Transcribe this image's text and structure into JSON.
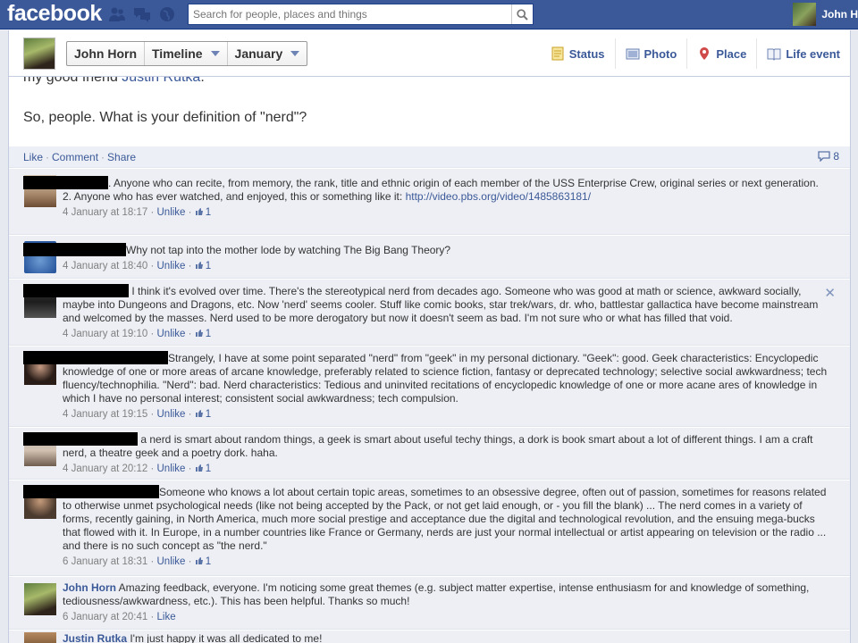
{
  "topbar": {
    "logo": "facebook",
    "search_placeholder": "Search for people, places and things",
    "user_name": "John H"
  },
  "timeline_header": {
    "crumbs": [
      {
        "label": "John Horn",
        "dropdown": false
      },
      {
        "label": "Timeline",
        "dropdown": true
      },
      {
        "label": "January",
        "dropdown": true
      }
    ],
    "composer": [
      {
        "label": "Status",
        "icon": "status-icon"
      },
      {
        "label": "Photo",
        "icon": "photo-icon"
      },
      {
        "label": "Place",
        "icon": "place-icon"
      },
      {
        "label": "Life event",
        "icon": "life-event-icon"
      }
    ]
  },
  "post": {
    "partial_line_prefix": "my good friend ",
    "partial_line_link": "Justin Rutka",
    "partial_line_suffix": ".",
    "question": "So, people. What is your definition of \"nerd\"?",
    "actions": {
      "like": "Like",
      "comment": "Comment",
      "share": "Share"
    },
    "comment_count": "8"
  },
  "comments": [
    {
      "text": ". Anyone who can recite, from memory, the rank, title and ethnic origin of each member of the USS Enterprise Crew, original series or next generation.",
      "text2_prefix": "2. Anyone who has ever watched, and enjoyed, this or something like it: ",
      "url": "http://video.pbs.org/video/1485863181/",
      "date": "4 January at 18:17",
      "action": "Unlike",
      "likes": "1"
    },
    {
      "text": "Why not tap into the mother lode by watching The Big Bang Theory?",
      "date": "4 January at 18:40",
      "action": "Unlike",
      "likes": "1"
    },
    {
      "text": " I think it's evolved over time. There's the stereotypical nerd from decades ago. Someone who was good at math or science, awkward socially, maybe into Dungeons and Dragons, etc. Now 'nerd' seems cooler. Stuff like comic books, star trek/wars, dr. who, battlestar gallactica have become mainstream and welcomed by the masses. Nerd used to be more derogatory but now it doesn't seem as bad. I'm not sure who or what has filled that void.",
      "date": "4 January at 19:10",
      "action": "Unlike",
      "likes": "1"
    },
    {
      "text": "Strangely, I have at some point separated \"nerd\" from \"geek\" in my personal dictionary. \"Geek\": good. Geek characteristics: Encyclopedic knowledge of one or more areas of arcane knowledge, preferably related to science fiction, fantasy or deprecated technology; selective social awkwardness; tech fluency/technophilia. \"Nerd\": bad. Nerd characteristics: Tedious and uninvited recitations of encyclopedic knowledge of one or more acane ares of knowledge in which I have no personal interest; consistent social awkwardness; tech compulsion.",
      "date": "4 January at 19:15",
      "action": "Unlike",
      "likes": "1"
    },
    {
      "text": " a nerd is smart about random things, a geek is smart about useful techy things, a dork is book smart about a lot of different things. I am a craft nerd, a theatre geek and a poetry dork. haha.",
      "date": "4 January at 20:12",
      "action": "Unlike",
      "likes": "1"
    },
    {
      "text": "Someone who knows a lot about certain topic areas, sometimes to an obsessive degree, often out of passion, sometimes for reasons related to otherwise unmet psychological needs (like not being accepted by the Pack, or not get laid enough, or - you fill the blank) ... The nerd comes in a variety of forms, recently gaining, in North America, much more social prestige and acceptance due the digital and technological revolution, and the ensuing mega-bucks that flowed with it. In Europe, in a number countries like France or Germany, nerds are just your normal intellectual or artist appearing on television or the radio ... and there is no such concept as \"the nerd.\"",
      "date": "6 January at 18:31",
      "action": "Unlike",
      "likes": "1"
    },
    {
      "name": "John Horn",
      "text": " Amazing feedback, everyone. I'm noticing some great themes (e.g. subject matter expertise, intense enthusiasm for and knowledge of something, tediousness/awkwardness, etc.). This has been helpful. Thanks so much!",
      "date": "6 January at 20:41",
      "action": "Like"
    },
    {
      "name": "Justin Rutka",
      "text": " I'm just happy it was all dedicated to me!"
    }
  ],
  "meta_sep": " · "
}
